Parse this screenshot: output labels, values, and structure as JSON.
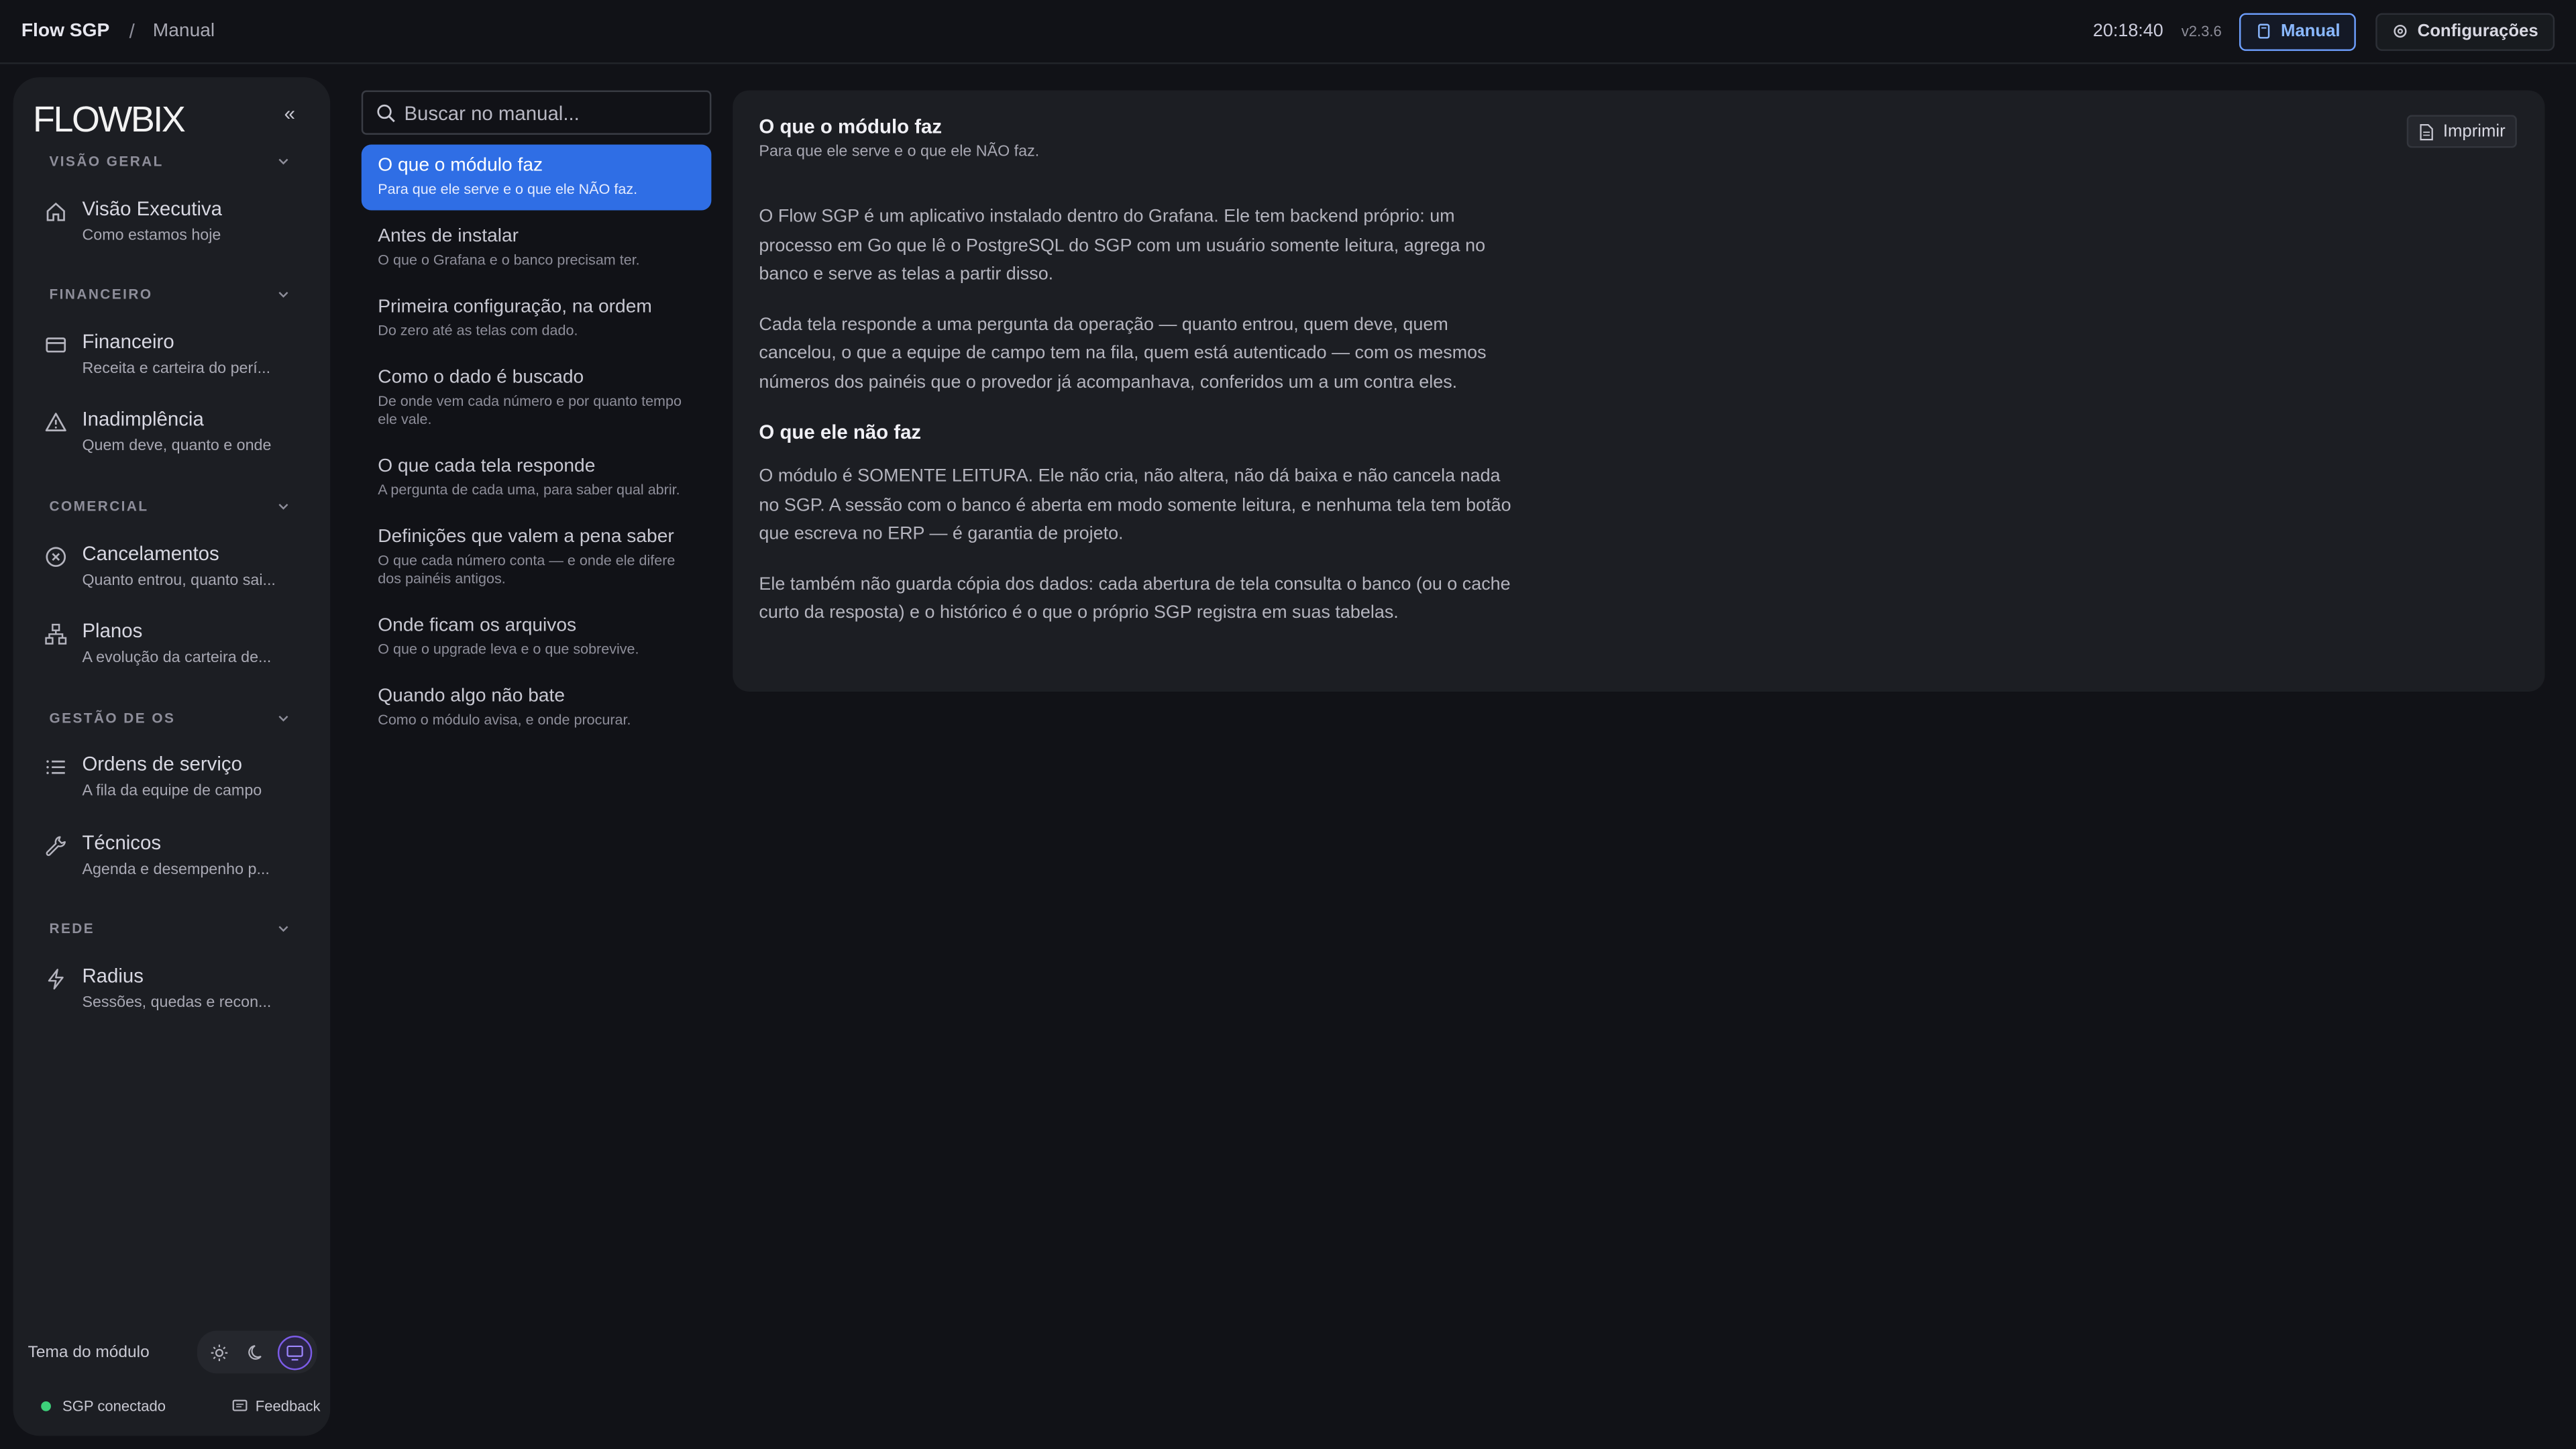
{
  "topbar": {
    "app": "Flow SGP",
    "separator": "/",
    "page": "Manual",
    "clock": "20:18:40",
    "version": "v2.3.6",
    "manual_label": "Manual",
    "config_label": "Configurações"
  },
  "sidebar": {
    "logo": "FLOWBIX",
    "collapse": "«",
    "sections": [
      {
        "label": "VISÃO GERAL",
        "items": [
          {
            "title": "Visão Executiva",
            "sub": "Como estamos hoje",
            "icon": "home-icon"
          }
        ]
      },
      {
        "label": "FINANCEIRO",
        "items": [
          {
            "title": "Financeiro",
            "sub": "Receita e carteira do perí...",
            "icon": "credit-card-icon"
          },
          {
            "title": "Inadimplência",
            "sub": "Quem deve, quanto e onde",
            "icon": "warning-icon"
          }
        ]
      },
      {
        "label": "COMERCIAL",
        "items": [
          {
            "title": "Cancelamentos",
            "sub": "Quanto entrou, quanto sai...",
            "icon": "circle-x-icon"
          },
          {
            "title": "Planos",
            "sub": "A evolução da carteira de...",
            "icon": "hierarchy-icon"
          }
        ]
      },
      {
        "label": "GESTÃO DE OS",
        "items": [
          {
            "title": "Ordens de serviço",
            "sub": "A fila da equipe de campo",
            "icon": "list-icon"
          },
          {
            "title": "Técnicos",
            "sub": "Agenda e desempenho p...",
            "icon": "wrench-icon"
          }
        ]
      },
      {
        "label": "REDE",
        "items": [
          {
            "title": "Radius",
            "sub": "Sessões, quedas e recon...",
            "icon": "bolt-icon"
          }
        ]
      }
    ],
    "theme_label": "Tema do módulo",
    "status": "SGP conectado",
    "feedback": "Feedback"
  },
  "search": {
    "placeholder": "Buscar no manual..."
  },
  "toc": [
    {
      "title": "O que o módulo faz",
      "sub": "Para que ele serve e o que ele NÃO faz."
    },
    {
      "title": "Antes de instalar",
      "sub": "O que o Grafana e o banco precisam ter."
    },
    {
      "title": "Primeira configuração, na ordem",
      "sub": "Do zero até as telas com dado."
    },
    {
      "title": "Como o dado é buscado",
      "sub": "De onde vem cada número e por quanto tempo ele vale."
    },
    {
      "title": "O que cada tela responde",
      "sub": "A pergunta de cada uma, para saber qual abrir."
    },
    {
      "title": "Definições que valem a pena saber",
      "sub": "O que cada número conta — e onde ele difere dos painéis antigos."
    },
    {
      "title": "Onde ficam os arquivos",
      "sub": "O que o upgrade leva e o que sobrevive."
    },
    {
      "title": "Quando algo não bate",
      "sub": "Como o módulo avisa, e onde procurar."
    }
  ],
  "content": {
    "title": "O que o módulo faz",
    "subtitle": "Para que ele serve e o que ele NÃO faz.",
    "print_label": "Imprimir",
    "p1": "O Flow SGP é um aplicativo instalado dentro do Grafana. Ele tem backend próprio: um processo em Go que lê o PostgreSQL do SGP com um usuário somente leitura, agrega no banco e serve as telas a partir disso.",
    "p2": "Cada tela responde a uma pergunta da operação — quanto entrou, quem deve, quem cancelou, o que a equipe de campo tem na fila, quem está autenticado — com os mesmos números dos painéis que o provedor já acompanhava, conferidos um a um contra eles.",
    "h2": "O que ele não faz",
    "p3": "O módulo é SOMENTE LEITURA. Ele não cria, não altera, não dá baixa e não cancela nada no SGP. A sessão com o banco é aberta em modo somente leitura, e nenhuma tela tem botão que escreva no ERP — é garantia de projeto.",
    "p4": "Ele também não guarda cópia dos dados: cada abertura de tela consulta o banco (ou o cache curto da resposta) e o histórico é o que o próprio SGP registra em suas tabelas."
  }
}
